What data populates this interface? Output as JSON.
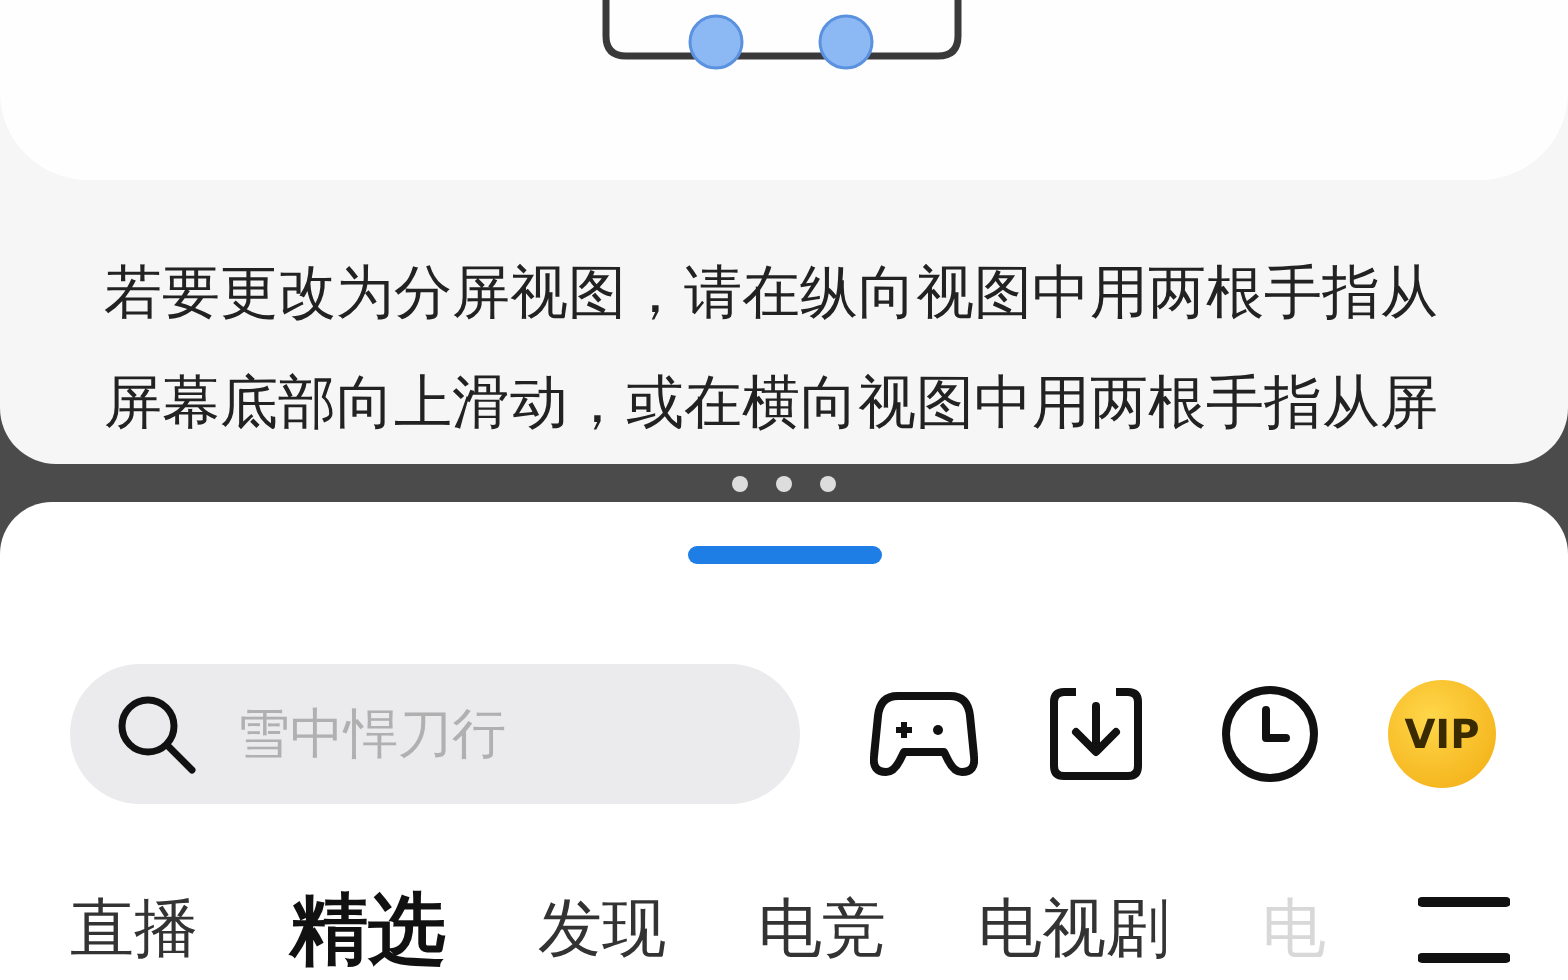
{
  "tip": {
    "text": "若要更改为分屏视图，请在纵向视图中用两根手指从屏幕底部向上滑动，或在横向视图中用两根手指从屏"
  },
  "search": {
    "placeholder": "雪中悍刀行"
  },
  "vip": {
    "label": "VIP"
  },
  "tabs": [
    {
      "label": "直播",
      "selected": false,
      "kind": "normal"
    },
    {
      "label": "精选",
      "selected": true,
      "kind": "normal"
    },
    {
      "label": "发现",
      "selected": false,
      "kind": "normal"
    },
    {
      "label": "电竞",
      "selected": false,
      "kind": "normal"
    },
    {
      "label": "电视剧",
      "selected": false,
      "kind": "normal"
    },
    {
      "label": "电",
      "selected": false,
      "kind": "faded"
    }
  ]
}
